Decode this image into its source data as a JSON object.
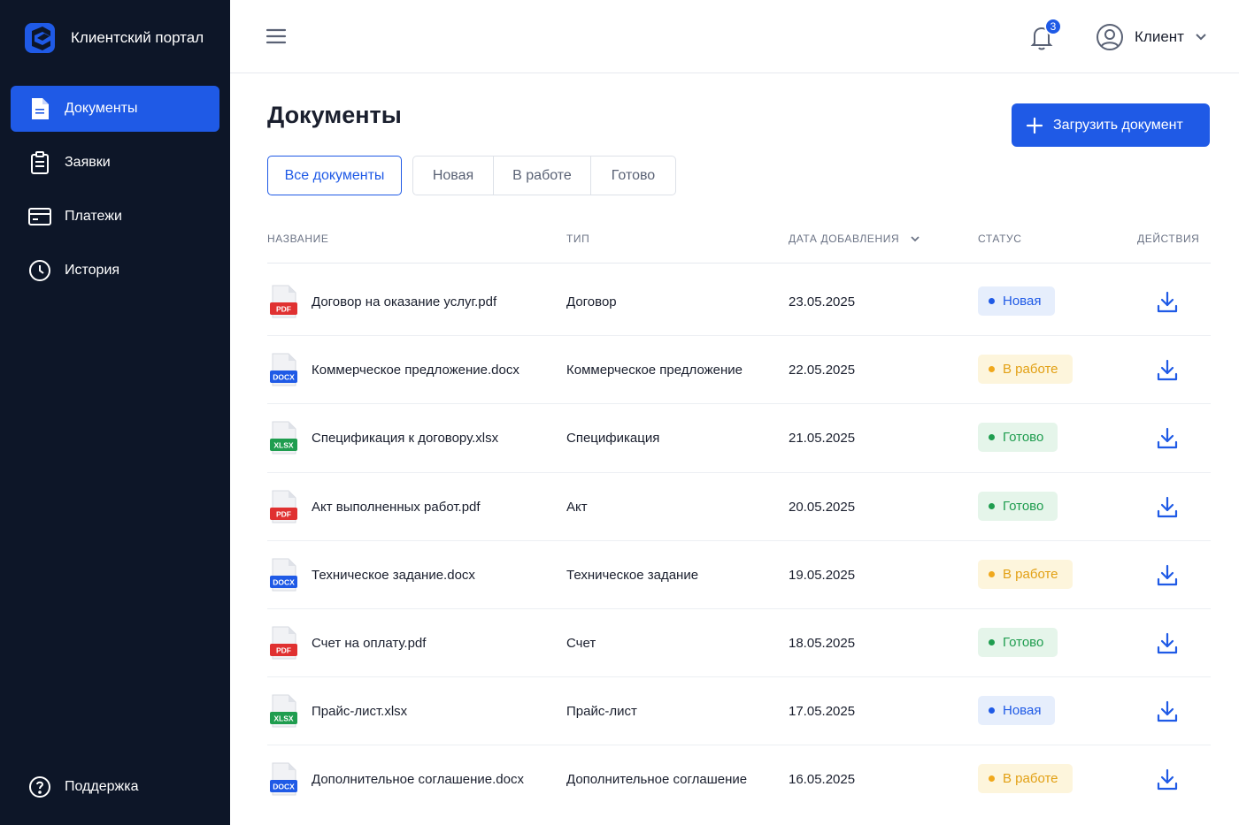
{
  "app": {
    "title": "Клиентский портал"
  },
  "sidebar": {
    "items": [
      {
        "label": "Документы",
        "icon": "document-icon",
        "active": true
      },
      {
        "label": "Заявки",
        "icon": "clipboard-icon",
        "active": false
      },
      {
        "label": "Платежи",
        "icon": "credit-card-icon",
        "active": false
      },
      {
        "label": "История",
        "icon": "clock-icon",
        "active": false
      }
    ],
    "support_label": "Поддержка"
  },
  "header": {
    "notifications_count": "3",
    "user_name": "Клиент"
  },
  "main": {
    "title": "Документы",
    "upload_label": "Загрузить документ",
    "tabs": {
      "all": "Все документы",
      "new": "Новая",
      "work": "В работе",
      "done": "Готово"
    },
    "columns": {
      "name": "Название",
      "type": "Тип",
      "date": "Дата добавления",
      "status": "Статус",
      "actions": "Действия"
    },
    "rows": [
      {
        "ext": "PDF",
        "name": "Договор на оказание услуг.pdf",
        "type": "Договор",
        "date": "23.05.2025",
        "status": "Новая"
      },
      {
        "ext": "DOCX",
        "name": "Коммерческое предложение.docx",
        "type": "Коммерческое предложение",
        "date": "22.05.2025",
        "status": "В работе"
      },
      {
        "ext": "XLSX",
        "name": "Спецификация к договору.xlsx",
        "type": "Спецификация",
        "date": "21.05.2025",
        "status": "Готово"
      },
      {
        "ext": "PDF",
        "name": "Акт выполненных работ.pdf",
        "type": "Акт",
        "date": "20.05.2025",
        "status": "Готово"
      },
      {
        "ext": "DOCX",
        "name": "Техническое задание.docx",
        "type": "Техническое задание",
        "date": "19.05.2025",
        "status": "В работе"
      },
      {
        "ext": "PDF",
        "name": "Счет на оплату.pdf",
        "type": "Счет",
        "date": "18.05.2025",
        "status": "Готово"
      },
      {
        "ext": "XLSX",
        "name": "Прайс-лист.xlsx",
        "type": "Прайс-лист",
        "date": "17.05.2025",
        "status": "Новая"
      },
      {
        "ext": "DOCX",
        "name": "Дополнительное соглашение.docx",
        "type": "Дополнительное соглашение",
        "date": "16.05.2025",
        "status": "В работе"
      }
    ]
  },
  "colors": {
    "sidebar_bg": "#0d1628",
    "accent": "#1f5ae6",
    "pdf": "#e03131",
    "docx": "#1f5ae6",
    "xlsx": "#1f9d4f",
    "status_new": "#1f5ae6",
    "status_work": "#f0a81c",
    "status_done": "#1f9d4f"
  }
}
